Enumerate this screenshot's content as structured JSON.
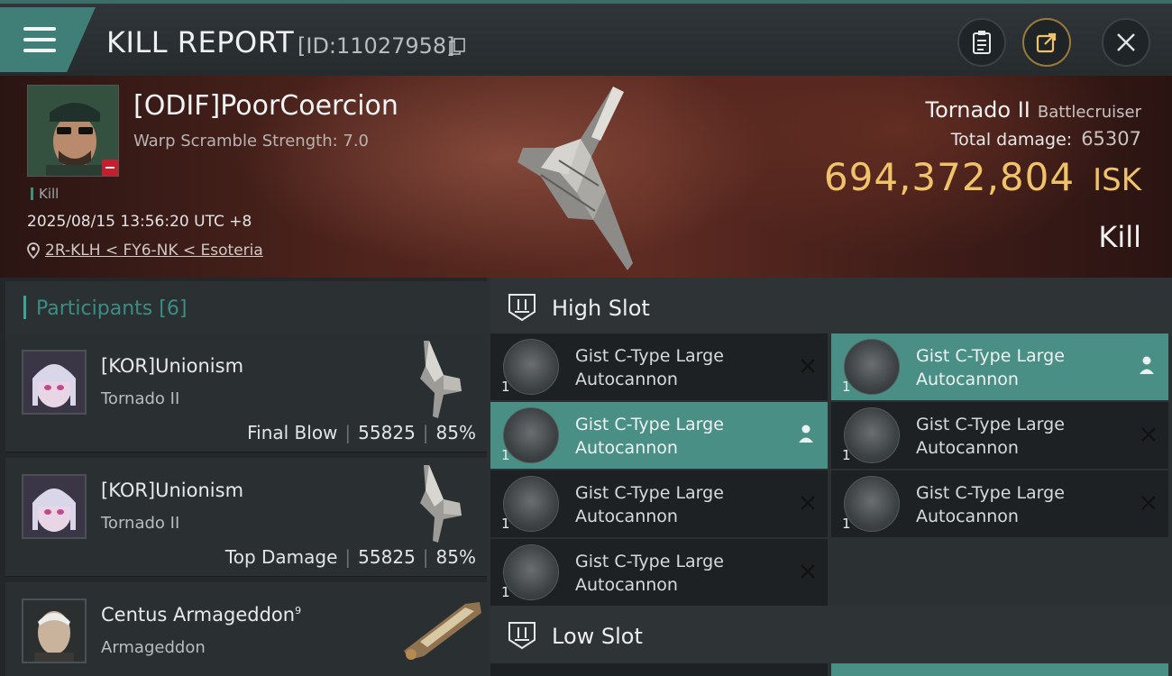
{
  "header": {
    "title": "KILL REPORT",
    "report_id": "[ID:11027958]"
  },
  "victim": {
    "pilot_name": "[ODIF]PoorCoercion",
    "warp_scramble": "Warp Scramble Strength: 7.0",
    "tag": "Kill",
    "datetime": "2025/08/15 13:56:20 UTC +8",
    "location": "2R-KLH < FY6-NK < Esoteria",
    "ship_name": "Tornado II",
    "ship_class": "Battlecruiser",
    "total_damage_label": "Total damage:",
    "total_damage_value": "65307",
    "isk_amount": "694,372,804",
    "isk_unit": "ISK",
    "result": "Kill"
  },
  "participants": {
    "label": "Participants",
    "count": "[6]",
    "items": [
      {
        "name": "[KOR]Unionism",
        "ship": "Tornado II",
        "stat_label": "Final Blow",
        "damage": "55825",
        "percent": "85%"
      },
      {
        "name": "[KOR]Unionism",
        "ship": "Tornado II",
        "stat_label": "Top Damage",
        "damage": "55825",
        "percent": "85%"
      },
      {
        "name": "Centus Armageddon",
        "name_sup": "9",
        "ship": "Armageddon"
      }
    ]
  },
  "slots": {
    "high": {
      "label": "High Slot",
      "modules": [
        {
          "qty": "1",
          "line1": "Gist C-Type Large",
          "line2": "Autocannon",
          "state": "destroyed"
        },
        {
          "qty": "1",
          "line1": "Gist C-Type Large",
          "line2": "Autocannon",
          "state": "dropped"
        },
        {
          "qty": "1",
          "line1": "Gist C-Type Large",
          "line2": "Autocannon",
          "state": "dropped"
        },
        {
          "qty": "1",
          "line1": "Gist C-Type Large",
          "line2": "Autocannon",
          "state": "destroyed"
        },
        {
          "qty": "1",
          "line1": "Gist C-Type Large",
          "line2": "Autocannon",
          "state": "destroyed"
        },
        {
          "qty": "1",
          "line1": "Gist C-Type Large",
          "line2": "Autocannon",
          "state": "destroyed"
        },
        {
          "qty": "1",
          "line1": "Gist C-Type Large",
          "line2": "Autocannon",
          "state": "destroyed"
        }
      ]
    },
    "low": {
      "label": "Low Slot"
    }
  },
  "colors": {
    "accent": "#3f7f77",
    "isk": "#f0c36a",
    "module_active": "#4a8f86",
    "module_default": "#1d2123",
    "badge_red": "#c81d2a"
  },
  "icons": {
    "menu": "hamburger-icon",
    "copy": "copy-icon",
    "clipboard": "clipboard-icon",
    "share": "share-icon",
    "close": "close-icon",
    "location": "location-pin-icon",
    "slot": "high-slot-icon",
    "person": "person-icon",
    "destroyed": "x-icon"
  }
}
